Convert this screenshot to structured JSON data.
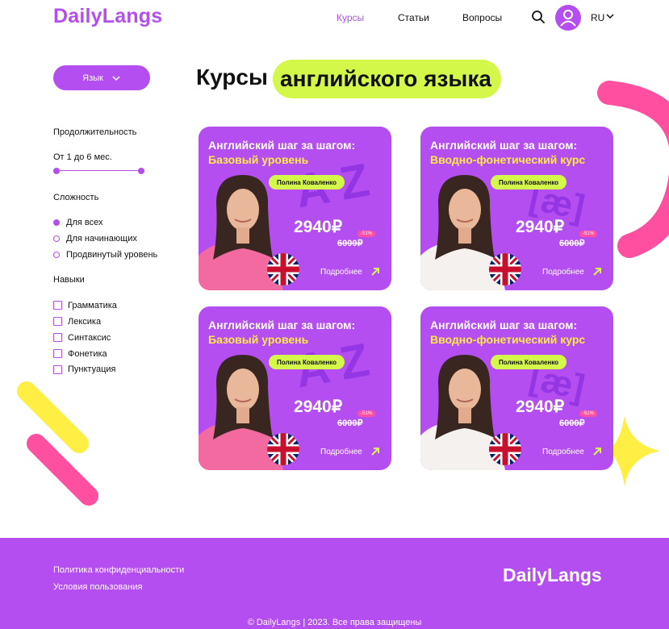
{
  "header": {
    "logo": "DailyLangs",
    "nav": [
      {
        "label": "Курсы",
        "active": true
      },
      {
        "label": "Статьи",
        "active": false
      },
      {
        "label": "Вопросы",
        "active": false
      }
    ],
    "language": "RU",
    "icons": {
      "search": "search-icon",
      "avatar": "user-avatar-icon",
      "chevron": "chevron-down-icon"
    }
  },
  "filters": {
    "language_button": "Язык",
    "duration": {
      "title": "Продолжительность",
      "range_label": "От 1 до 6 мес."
    },
    "difficulty": {
      "title": "Сложность",
      "options": [
        {
          "label": "Для всех",
          "selected": true
        },
        {
          "label": "Для начинающих",
          "selected": false
        },
        {
          "label": "Продвинутый уровень",
          "selected": false
        }
      ]
    },
    "skills": {
      "title": "Навыки",
      "options": [
        {
          "label": "Грамматика",
          "checked": false
        },
        {
          "label": "Лексика",
          "checked": false
        },
        {
          "label": "Синтаксис",
          "checked": false
        },
        {
          "label": "Фонетика",
          "checked": false
        },
        {
          "label": "Пунктуация",
          "checked": false
        }
      ]
    }
  },
  "page_title": {
    "plain": "Курсы",
    "highlight": "английского языка"
  },
  "cards": [
    {
      "title": "Английский шаг за шагом:",
      "subtitle": "Базовый уровень",
      "tutor": "Полина Коваленко",
      "price": "2940₽",
      "old_price": "6000₽",
      "discount": "-51%",
      "more": "Подробнее",
      "letters": "A Z"
    },
    {
      "title": "Английский шаг за шагом:",
      "subtitle": "Вводно-фонетический курс",
      "tutor": "Полина Коваленко",
      "price": "2940₽",
      "old_price": "6000₽",
      "discount": "-51%",
      "more": "Подробнее",
      "letters": "[æ]"
    },
    {
      "title": "Английский шаг за шагом:",
      "subtitle": "Базовый уровень",
      "tutor": "Полина Коваленко",
      "price": "2940₽",
      "old_price": "6000₽",
      "discount": "-51%",
      "more": "Подробнее",
      "letters": "A Z"
    },
    {
      "title": "Английский шаг за шагом:",
      "subtitle": "Вводно-фонетический курс",
      "tutor": "Полина Коваленко",
      "price": "2940₽",
      "old_price": "6000₽",
      "discount": "-51%",
      "more": "Подробнее",
      "letters": "[æ]"
    }
  ],
  "footer": {
    "links": [
      "Политика конфиденциальности",
      "Условия пользования"
    ],
    "logo": "DailyLangs",
    "copyright": "© DailyLangs | 2023. Все права защищены"
  },
  "colors": {
    "brand": "#b44ef0",
    "accent_lime": "#d4f84a",
    "accent_pink": "#ff4fa0",
    "accent_yellow": "#ffe94a"
  }
}
